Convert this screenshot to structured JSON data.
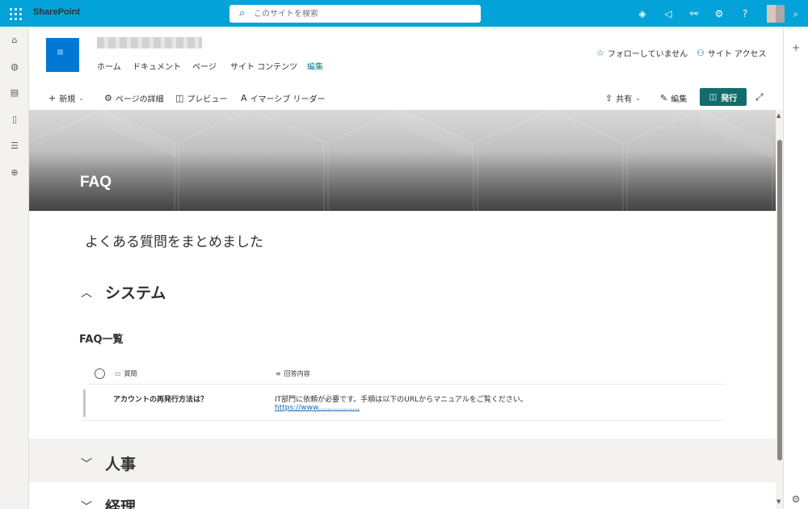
{
  "topbar": {
    "brand": "SharePoint",
    "search_placeholder": "このサイトを検索",
    "help_label": "?"
  },
  "site": {
    "nav": [
      "ホーム",
      "ドキュメント",
      "ページ",
      "サイト コンテンツ",
      "編集"
    ],
    "follow": "フォローしていません",
    "site_access": "サイト アクセス"
  },
  "commandbar": {
    "new": "新規",
    "page_details": "ページの詳細",
    "preview": "プレビュー",
    "immersive_reader": "イマーシブ リーダー",
    "share": "共有",
    "edit": "編集",
    "publish": "発行"
  },
  "page": {
    "title": "FAQ",
    "summary": "よくある質問をまとめました"
  },
  "sections": [
    {
      "title": "システム",
      "expanded": true
    },
    {
      "title": "人事",
      "expanded": false
    },
    {
      "title": "経理",
      "expanded": false
    }
  ],
  "faq_list": {
    "title": "FAQ一覧",
    "columns": [
      "質問",
      "回答内容"
    ],
    "rows": [
      {
        "question": "アカウントの再発行方法は？",
        "answer": "IT部門に依頼が必要です。手順は以下のURLからマニュアルをご覧ください。",
        "link": "https://www.................."
      }
    ]
  },
  "icons": {
    "search": "search-icon",
    "accent": "#03a2d8",
    "publish_color": "#106d6b"
  }
}
